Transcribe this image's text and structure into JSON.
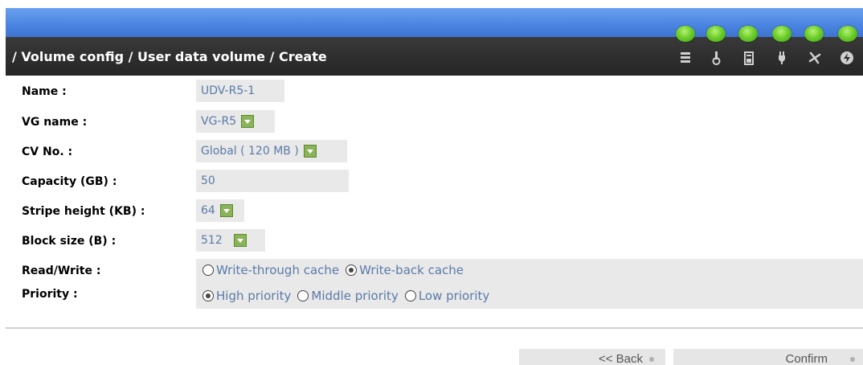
{
  "breadcrumb": "/ Volume config / User data volume / Create",
  "status_icons": [
    "disk-stack-icon",
    "temperature-icon",
    "battery-icon",
    "power-plug-icon",
    "fan-icon",
    "voltage-icon"
  ],
  "led_color": "#6ed02a",
  "form": {
    "name": {
      "label": "Name :",
      "value": "UDV-R5-1"
    },
    "vg_name": {
      "label": "VG name :",
      "value": "VG-R5"
    },
    "cv_no": {
      "label": "CV No. :",
      "value": "Global ( 120 MB )"
    },
    "capacity": {
      "label": "Capacity (GB) :",
      "value": "50"
    },
    "stripe_height": {
      "label": "Stripe height (KB) :",
      "value": "64"
    },
    "block_size": {
      "label": "Block size (B) :",
      "value": "512"
    },
    "read_write": {
      "label": "Read/Write :",
      "options": [
        {
          "label": "Write-through cache",
          "checked": false
        },
        {
          "label": "Write-back cache",
          "checked": true
        }
      ]
    },
    "priority": {
      "label": "Priority :",
      "options": [
        {
          "label": "High priority",
          "checked": true
        },
        {
          "label": "Middle priority",
          "checked": false
        },
        {
          "label": "Low priority",
          "checked": false
        }
      ]
    }
  },
  "buttons": {
    "back": "<< Back",
    "confirm": "Confirm"
  }
}
